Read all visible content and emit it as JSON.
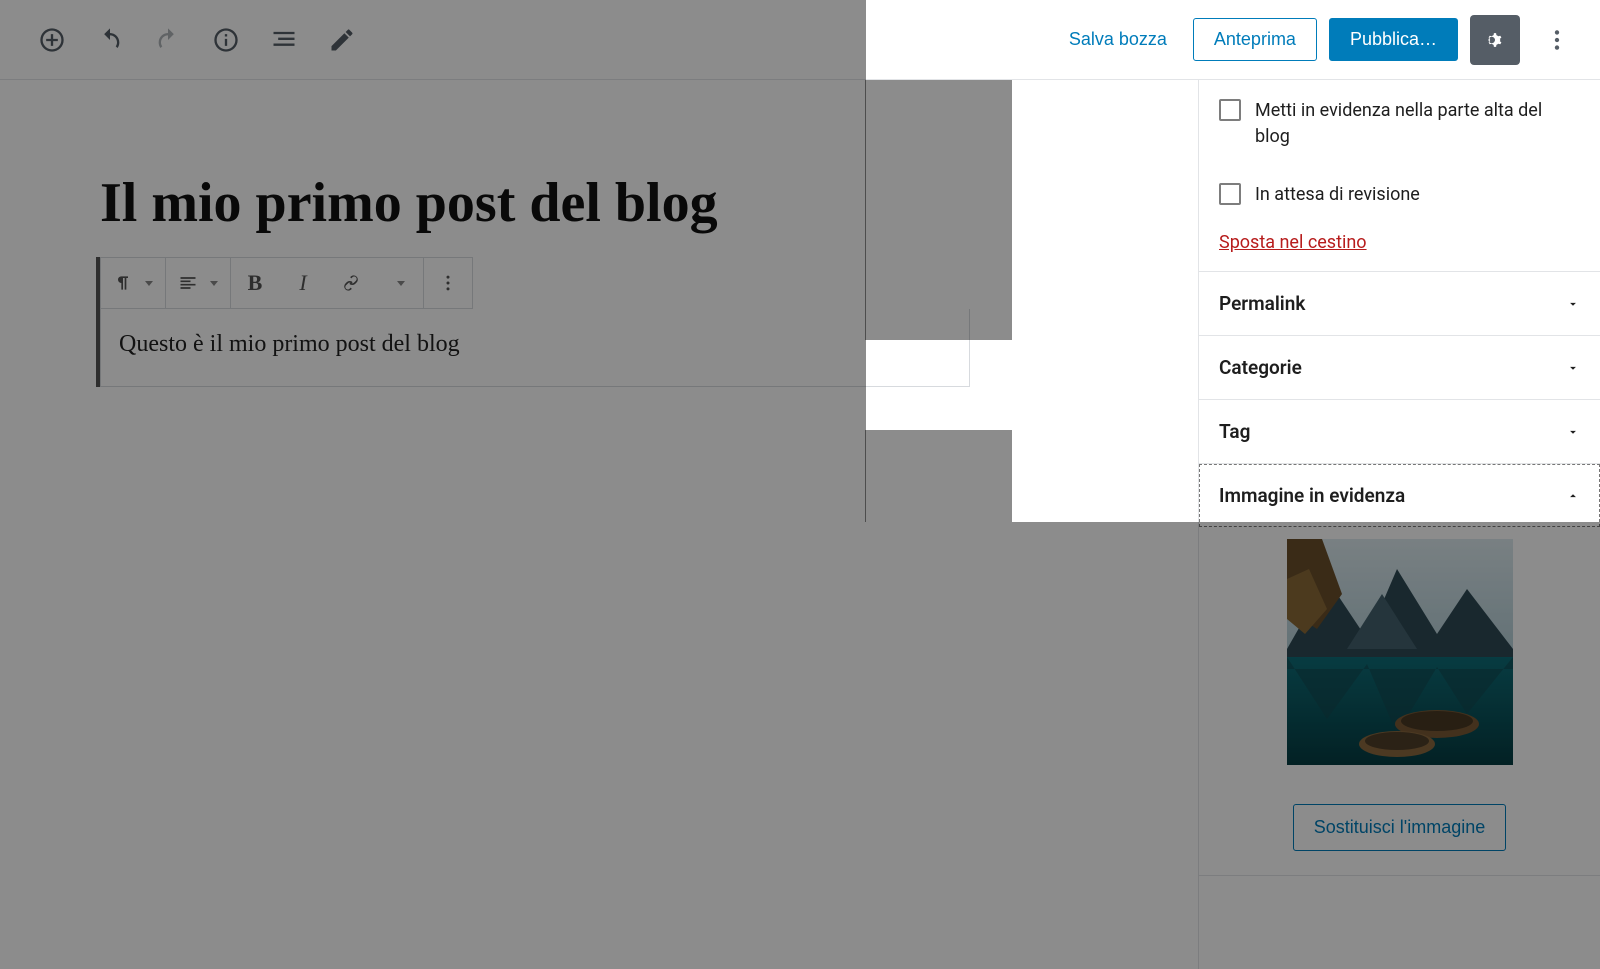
{
  "header": {
    "save_draft": "Salva bozza",
    "preview": "Anteprima",
    "publish": "Pubblica…"
  },
  "editor": {
    "title": "Il mio primo post del blog",
    "paragraph": "Questo è il mio primo post del blog",
    "toolbar": {
      "bold": "B",
      "italic": "I"
    }
  },
  "sidebar": {
    "stick_top": "Metti in evidenza nella parte alta del blog",
    "pending_review": "In attesa di revisione",
    "trash": "Sposta nel cestino",
    "permalink": "Permalink",
    "categories": "Categorie",
    "tags": "Tag",
    "featured_image": "Immagine in evidenza",
    "replace_image": "Sostituisci l'immagine"
  }
}
